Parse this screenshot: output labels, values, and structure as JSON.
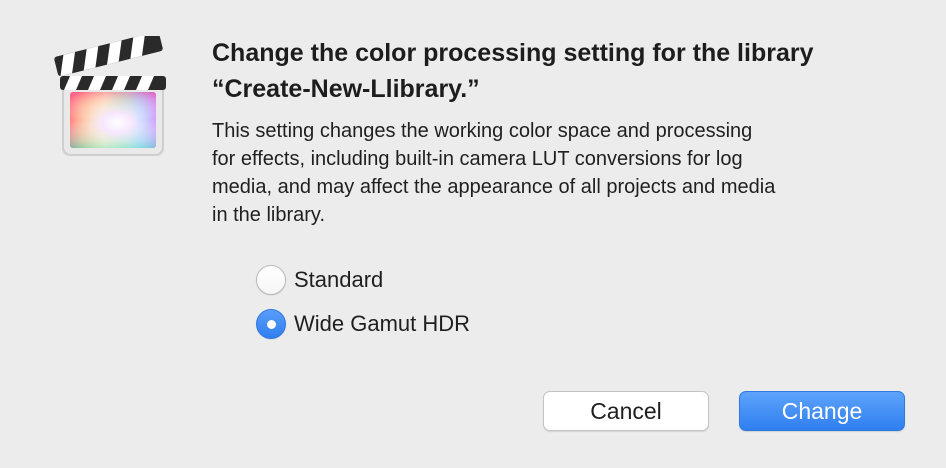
{
  "dialog": {
    "app_icon": "final-cut-pro-clapperboard-icon",
    "title_lines": [
      "Change the color processing setting for the library",
      "“Create-New-Llibrary.”"
    ],
    "message_lines": [
      "This setting changes the working color space and processing",
      "for effects, including built-in camera LUT conversions for log",
      "media, and may affect the appearance of all projects and media",
      "in the library."
    ],
    "options": [
      {
        "label": "Standard",
        "selected": false
      },
      {
        "label": "Wide Gamut HDR",
        "selected": true
      }
    ],
    "buttons": {
      "cancel_label": "Cancel",
      "change_label": "Change"
    },
    "colors": {
      "accent": "#2f7ff0",
      "background": "#ececec"
    }
  }
}
